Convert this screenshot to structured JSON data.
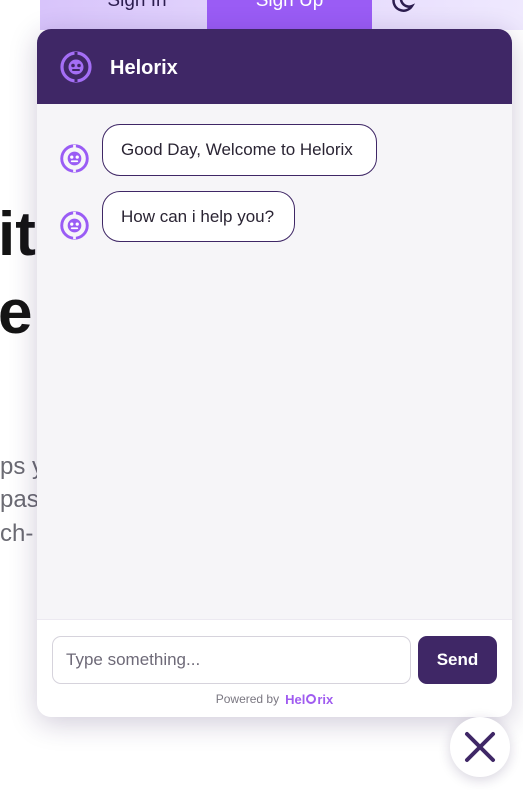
{
  "background": {
    "nav": {
      "sign_in": "Sign In",
      "sign_up": "Sign Up",
      "theme_icon": "moon-icon"
    },
    "hero": {
      "heading_line1": "it",
      "heading_line2": "e",
      "paragraph_line1": "ps y",
      "paragraph_line2": "pas",
      "paragraph_line3": "ch-"
    }
  },
  "chat": {
    "header": {
      "title": "Helorix",
      "icon": "bot-logo-icon"
    },
    "messages": [
      {
        "sender": "bot",
        "text": "Good Day, Welcome to Helorix"
      },
      {
        "sender": "bot",
        "text": "How can i help you?"
      }
    ],
    "input": {
      "value": "",
      "placeholder": "Type something..."
    },
    "send_label": "Send",
    "powered_by": "Powered by",
    "brand_logo": {
      "part1": "Hel",
      "part2": "rix"
    },
    "close_icon": "close-icon"
  },
  "colors": {
    "primary": "#3f2766",
    "accent": "#9a5cf5",
    "chat_background": "#f6f5f8"
  }
}
